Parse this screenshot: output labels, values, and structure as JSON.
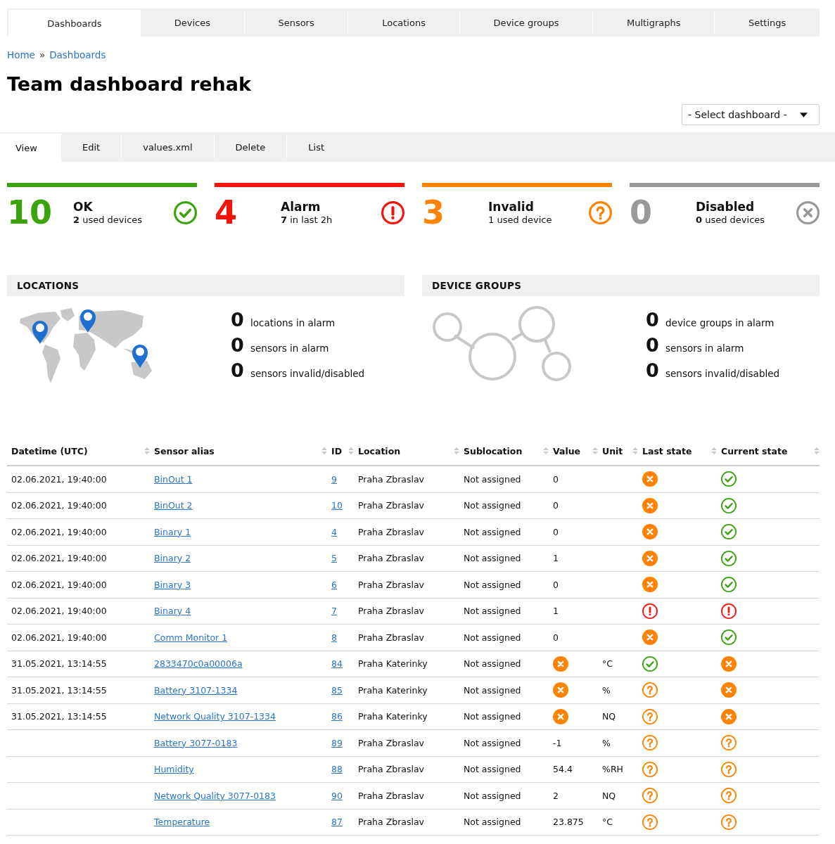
{
  "nav_tabs": [
    {
      "label": "Dashboards",
      "selected": true
    },
    {
      "label": "Devices",
      "selected": false
    },
    {
      "label": "Sensors",
      "selected": false
    },
    {
      "label": "Locations",
      "selected": false
    },
    {
      "label": "Device groups",
      "selected": false
    },
    {
      "label": "Multigraphs",
      "selected": false
    },
    {
      "label": "Settings",
      "selected": false
    }
  ],
  "breadcrumb": {
    "items": [
      "Home",
      "Dashboards"
    ],
    "separator": "»"
  },
  "title": "Team dashboard rehak",
  "dashboard_select": {
    "value": "- Select dashboard -"
  },
  "action_tabs": [
    {
      "label": "View",
      "selected": true
    },
    {
      "label": "Edit",
      "selected": false
    },
    {
      "label": "values.xml",
      "selected": false
    },
    {
      "label": "Delete",
      "selected": false
    },
    {
      "label": "List",
      "selected": false
    }
  ],
  "summary": [
    {
      "kind": "ok",
      "count": "10",
      "label": "OK",
      "detail": "**2** used devices",
      "color": "#3aa30d"
    },
    {
      "kind": "alarm",
      "count": "4",
      "label": "Alarm",
      "detail": "**7** in last 2h",
      "color": "#f0140a"
    },
    {
      "kind": "invalid",
      "count": "3",
      "label": "Invalid",
      "detail": "1 used device",
      "color": "#ff8200"
    },
    {
      "kind": "disabled",
      "count": "0",
      "label": "Disabled",
      "detail": "**0** used devices",
      "color": "#999999"
    }
  ],
  "locations": {
    "title": "LOCATIONS",
    "stats": [
      {
        "count": "0",
        "label": "locations in alarm"
      },
      {
        "count": "0",
        "label": "sensors in alarm"
      },
      {
        "count": "0",
        "label": "sensors invalid/disabled"
      }
    ]
  },
  "device_groups": {
    "title": "DEVICE GROUPS",
    "stats": [
      {
        "count": "0",
        "label": "device groups in alarm"
      },
      {
        "count": "0",
        "label": "sensors in alarm"
      },
      {
        "count": "0",
        "label": "sensors invalid/disabled"
      }
    ]
  },
  "table": {
    "columns": [
      "Datetime (UTC)",
      "Sensor alias",
      "ID",
      "Location",
      "Sublocation",
      "Value",
      "Unit",
      "Last state",
      "Current state"
    ],
    "rows": [
      {
        "datetime": "02.06.2021, 19:40:00",
        "alias": "BinOut 1",
        "id": "9",
        "location": "Praha Zbraslav",
        "sublocation": "Not assigned",
        "value": "0",
        "last_state": {
          "kind": "error"
        },
        "current_state": {
          "kind": "ok"
        }
      },
      {
        "datetime": "02.06.2021, 19:40:00",
        "alias": "BinOut 2",
        "id": "10",
        "location": "Praha Zbraslav",
        "sublocation": "Not assigned",
        "value": "0",
        "last_state": {
          "kind": "error"
        },
        "current_state": {
          "kind": "ok"
        }
      },
      {
        "datetime": "02.06.2021, 19:40:00",
        "alias": "Binary 1",
        "id": "4",
        "location": "Praha Zbraslav",
        "sublocation": "Not assigned",
        "value": "0",
        "last_state": {
          "kind": "error"
        },
        "current_state": {
          "kind": "ok"
        }
      },
      {
        "datetime": "02.06.2021, 19:40:00",
        "alias": "Binary 2",
        "id": "5",
        "location": "Praha Zbraslav",
        "sublocation": "Not assigned",
        "value": "1",
        "last_state": {
          "kind": "error"
        },
        "current_state": {
          "kind": "ok"
        }
      },
      {
        "datetime": "02.06.2021, 19:40:00",
        "alias": "Binary 3",
        "id": "6",
        "location": "Praha Zbraslav",
        "sublocation": "Not assigned",
        "value": "0",
        "last_state": {
          "kind": "error"
        },
        "current_state": {
          "kind": "ok"
        }
      },
      {
        "datetime": "02.06.2021, 19:40:00",
        "alias": "Binary 4",
        "id": "7",
        "location": "Praha Zbraslav",
        "sublocation": "Not assigned",
        "value": "1",
        "last_state": {
          "kind": "alarm"
        },
        "current_state": {
          "kind": "alarm"
        }
      },
      {
        "datetime": "02.06.2021, 19:40:00",
        "alias": "Comm Monitor 1",
        "id": "8",
        "location": "Praha Zbraslav",
        "sublocation": "Not assigned",
        "value": "0",
        "last_state": {
          "kind": "error"
        },
        "current_state": {
          "kind": "ok"
        }
      },
      {
        "datetime": "31.05.2021, 13:14:55",
        "alias": "2833470c0a00006a",
        "id": "84",
        "location": "Praha Katerinky",
        "sublocation": "Not assigned",
        "value_icon": {
          "kind": "error"
        },
        "unit": "°C",
        "last_state": {
          "kind": "ok"
        },
        "current_state": {
          "kind": "error"
        }
      },
      {
        "datetime": "31.05.2021, 13:14:55",
        "alias": "Battery 3107-1334",
        "id": "85",
        "location": "Praha Katerinky",
        "sublocation": "Not assigned",
        "value_icon": {
          "kind": "error"
        },
        "unit": "%",
        "last_state": {
          "kind": "invalid"
        },
        "current_state": {
          "kind": "error"
        }
      },
      {
        "datetime": "31.05.2021, 13:14:55",
        "alias": "Network Quality 3107-1334",
        "id": "86",
        "location": "Praha Katerinky",
        "sublocation": "Not assigned",
        "value_icon": {
          "kind": "error"
        },
        "unit": "NQ",
        "last_state": {
          "kind": "invalid"
        },
        "current_state": {
          "kind": "error"
        }
      },
      {
        "alias": "Battery 3077-0183",
        "id": "89",
        "location": "Praha Zbraslav",
        "sublocation": "Not assigned",
        "value": "-1",
        "unit": "%",
        "last_state": {
          "kind": "invalid"
        },
        "current_state": {
          "kind": "invalid"
        }
      },
      {
        "alias": "Humidity",
        "id": "88",
        "location": "Praha Zbraslav",
        "sublocation": "Not assigned",
        "value": "54.4",
        "unit": "%RH",
        "last_state": {
          "kind": "invalid"
        },
        "current_state": {
          "kind": "invalid"
        }
      },
      {
        "alias": "Network Quality 3077-0183",
        "id": "90",
        "location": "Praha Zbraslav",
        "sublocation": "Not assigned",
        "value": "2",
        "unit": "NQ",
        "last_state": {
          "kind": "invalid"
        },
        "current_state": {
          "kind": "invalid"
        }
      },
      {
        "alias": "Temperature",
        "id": "87",
        "location": "Praha Zbraslav",
        "sublocation": "Not assigned",
        "value": "23.875",
        "unit": "°C",
        "last_state": {
          "kind": "invalid"
        },
        "current_state": {
          "kind": "invalid"
        }
      }
    ]
  }
}
